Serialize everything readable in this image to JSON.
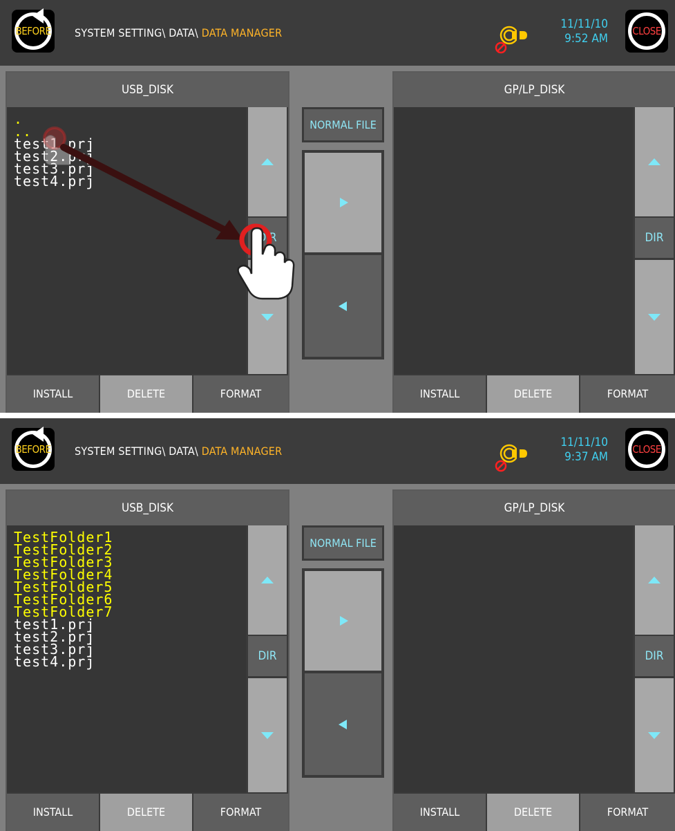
{
  "screens": [
    {
      "header": {
        "before_label": "BEFORE",
        "close_label": "CLOSE",
        "breadcrumb_prefix": "SYSTEM SETTING\\ DATA\\ ",
        "breadcrumb_current": "DATA MANAGER",
        "date": "11/11/10",
        "time": "9:52 AM"
      },
      "left_panel": {
        "title": "USB_DISK",
        "files": [
          {
            "name": ".",
            "color": "yellow"
          },
          {
            "name": "..",
            "color": "yellow"
          },
          {
            "name": "test1.prj",
            "color": "white"
          },
          {
            "name": "test2.prj",
            "color": "white"
          },
          {
            "name": "test3.prj",
            "color": "white"
          },
          {
            "name": "test4.prj",
            "color": "white"
          }
        ],
        "dir_label": "DIR",
        "install_label": "INSTALL",
        "delete_label": "DELETE",
        "format_label": "FORMAT"
      },
      "middle": {
        "normal_file_label": "NORMAL FILE"
      },
      "right_panel": {
        "title": "GP/LP_DISK",
        "files": [],
        "dir_label": "DIR",
        "install_label": "INSTALL",
        "delete_label": "DELETE",
        "format_label": "FORMAT"
      },
      "gesture": "tap-drag-to-dir"
    },
    {
      "header": {
        "before_label": "BEFORE",
        "close_label": "CLOSE",
        "breadcrumb_prefix": "SYSTEM SETTING\\ DATA\\ ",
        "breadcrumb_current": "DATA MANAGER",
        "date": "11/11/10",
        "time": "9:37 AM"
      },
      "left_panel": {
        "title": "USB_DISK",
        "files": [
          {
            "name": "TestFolder1",
            "color": "yellow"
          },
          {
            "name": "TestFolder2",
            "color": "yellow"
          },
          {
            "name": "TestFolder3",
            "color": "yellow"
          },
          {
            "name": "TestFolder4",
            "color": "yellow"
          },
          {
            "name": "TestFolder5",
            "color": "yellow"
          },
          {
            "name": "TestFolder6",
            "color": "yellow"
          },
          {
            "name": "TestFolder7",
            "color": "yellow"
          },
          {
            "name": "test1.prj",
            "color": "white"
          },
          {
            "name": "test2.prj",
            "color": "white"
          },
          {
            "name": "test3.prj",
            "color": "white"
          },
          {
            "name": "test4.prj",
            "color": "white"
          }
        ],
        "dir_label": "DIR",
        "install_label": "INSTALL",
        "delete_label": "DELETE",
        "format_label": "FORMAT"
      },
      "middle": {
        "normal_file_label": "NORMAL FILE"
      },
      "right_panel": {
        "title": "GP/LP_DISK",
        "files": [],
        "dir_label": "DIR",
        "install_label": "INSTALL",
        "delete_label": "DELETE",
        "format_label": "FORMAT"
      }
    }
  ],
  "icons": {
    "before": "rotate-back-icon",
    "close": "close-ring-icon",
    "network": "network-disconnected-icon",
    "scroll_up": "triangle-up-icon",
    "scroll_down": "triangle-down-icon",
    "copy_right": "triangle-right-icon",
    "copy_left": "triangle-left-icon"
  },
  "colors": {
    "topbar": "#3c3c3c",
    "panel_bg": "#363636",
    "button_dark": "#5e5e5e",
    "button_light": "#a8a8a8",
    "accent_cyan": "#40d0f0",
    "folder_yellow": "#ffff00",
    "breadcrumb_orange": "#ffb428"
  }
}
